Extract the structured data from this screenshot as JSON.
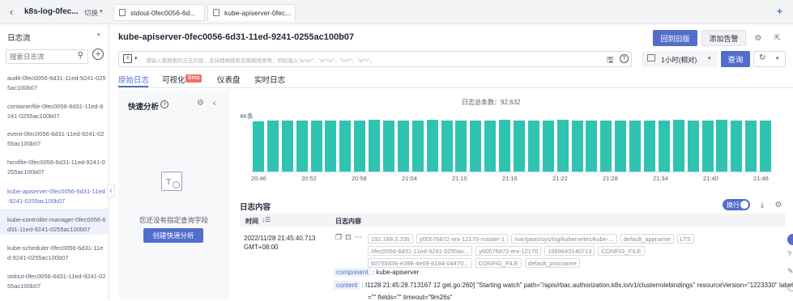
{
  "top": {
    "back_glyph": "‹",
    "project": "k8s-log-0fec...",
    "switch": "切换",
    "tabs": [
      "stdout-0fec0056-6d...",
      "kube-apiserver-0fec..."
    ],
    "add_glyph": "+"
  },
  "sidebar": {
    "title": "日志流",
    "search_placeholder": "搜索日志流",
    "items": [
      {
        "label": "audit-0fec0056-6d31-11ed-9241-0255ac100b07",
        "active": false
      },
      {
        "label": "containerfile-0fec0056-6d31-11ed-9241-0255ac100b07",
        "active": false
      },
      {
        "label": "event-0fec0056-6d31-11ed-9241-0255ac100b07",
        "active": false
      },
      {
        "label": "hostfile-0fec0056-6d31-11ed-9241-0255ac100b07",
        "active": false
      },
      {
        "label": "kube-apiserver-0fec0056-6d31-11ed-9241-0255ac100b07",
        "active": true
      },
      {
        "label": "kube-controller-manager-0fec0056-6d31-11ed-9241-0255ac100b07",
        "active": false
      },
      {
        "label": "kube-scheduler-0fec0056-6d31-11ed-9241-0255ac100b07",
        "active": false
      },
      {
        "label": "stdout-0fec0056-6d31-11ed-9241-0255ac100b07",
        "active": false
      }
    ]
  },
  "header": {
    "title": "kube-apiserver-0fec0056-6d31-11ed-9241-0255ac100b07",
    "btn_old": "回到旧版",
    "btn_alarm": "添加告警"
  },
  "search": {
    "placeholder": "请输入要搜索的日志内容，支持精确搜索及模糊搜索等，例如输入\"error\"、\"er?or\"、\"rro*\"、\"er*r\"。",
    "time_label": "1小时(相对)",
    "query_button": "查询"
  },
  "view_tabs": [
    "原始日志",
    "可视化",
    "仪表盘",
    "实时日志"
  ],
  "beta_badge": "Beta",
  "quick": {
    "title": "快速分析",
    "empty_text": "您还没有指定查询字段",
    "create_button": "创建快速分析"
  },
  "chart_data": {
    "type": "bar",
    "title": "日志总条数：92,632",
    "ylabel_tick": "4K条",
    "x_ticks": [
      "20:46",
      "20:52",
      "20:58",
      "21:04",
      "21:10",
      "21:16",
      "21:22",
      "21:28",
      "21:34",
      "21:40",
      "21:46"
    ],
    "values": [
      3600,
      3700,
      3700,
      3700,
      3650,
      3700,
      3700,
      3650,
      3750,
      3700,
      3650,
      3700,
      3750,
      3700,
      3700,
      3650,
      3700,
      3750,
      3700,
      3650,
      3700,
      3750,
      3700,
      3700,
      3700,
      3650,
      3700,
      3650,
      3700,
      3750,
      3650,
      3700,
      3750,
      3700,
      3700,
      3700
    ],
    "ymax": 4200,
    "color": "#2fc3b1"
  },
  "logs": {
    "section_title": "日志内容",
    "wrap_label": "换行",
    "col_time": "时间",
    "col_content": "日志内容",
    "row": {
      "time": "2022/11/28 21:45:40.713",
      "tz": "GMT+08:00",
      "tags": [
        "192.168.0.235",
        "y00576872-eni-12170-master-1",
        "/var/paas/sys/log/kubernetes/kube-...",
        "default_appname",
        "LTS",
        "0fec0056-6d31-11ed-9241-0255ac...",
        "y00576872-eni-12170",
        "1669643140713",
        "CONFIG_FILE",
        "b0755d36-e398-4e69-b184-04470...",
        "CONFIG_FILE",
        "default_procname"
      ],
      "component_key": "component",
      "component_val": "kube-apiserver",
      "content_key": "content",
      "content_val": "I1128 21:45:28.713167      12 get.go:260] \"Starting watch\" path=\"/apis/rbac.authorization.k8s.io/v1/clusterrolebindings\" resourceVersion=\"1223330\" labels",
      "content_cont": "=\"\" fields=\"\" timeout=\"9m26s\""
    }
  }
}
